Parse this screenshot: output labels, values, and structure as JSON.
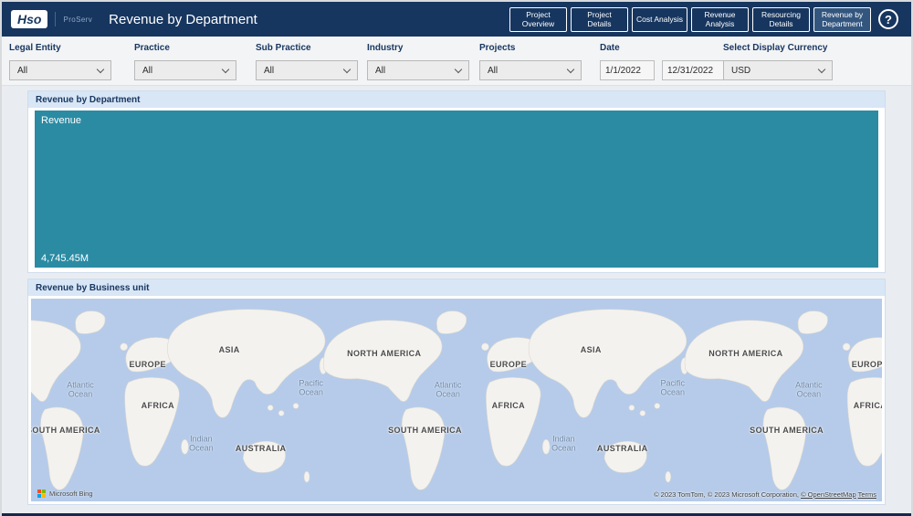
{
  "header": {
    "logo_text": "Hso",
    "brand": "ProServ",
    "title": "Revenue by Department",
    "help_label": "?",
    "nav": [
      {
        "label": "Project Overview",
        "active": false
      },
      {
        "label": "Project Details",
        "active": false
      },
      {
        "label": "Cost Analysis",
        "active": false
      },
      {
        "label": "Revenue Analysis",
        "active": false
      },
      {
        "label": "Resourcing Details",
        "active": false
      },
      {
        "label": "Revenue by Department",
        "active": true
      }
    ]
  },
  "filters": {
    "legal_entity": {
      "label": "Legal Entity",
      "value": "All"
    },
    "practice": {
      "label": "Practice",
      "value": "All"
    },
    "sub_practice": {
      "label": "Sub Practice",
      "value": "All"
    },
    "industry": {
      "label": "Industry",
      "value": "All"
    },
    "projects": {
      "label": "Projects",
      "value": "All"
    },
    "date": {
      "label": "Date",
      "start": "1/1/2022",
      "end": "12/31/2022"
    },
    "currency": {
      "label": "Select Display Currency",
      "value": "USD"
    }
  },
  "treemap_card": {
    "title": "Revenue by Department",
    "node_label": "Revenue",
    "node_value": "4,745.45M",
    "color": "#2b8ba3"
  },
  "map_card": {
    "title": "Revenue by Business unit",
    "bing_label": "Microsoft Bing",
    "attribution_prefix": "© 2023 TomTom, © 2023 Microsoft Corporation, ",
    "osm_link": "© OpenStreetMap",
    "terms_link": "Terms",
    "labels": [
      {
        "text": "SOUTH AMERICA"
      },
      {
        "text": "Atlantic\nOcean"
      },
      {
        "text": "EUROPE"
      },
      {
        "text": "AFRICA"
      },
      {
        "text": "Indian\nOcean"
      },
      {
        "text": "ASIA"
      },
      {
        "text": "AUSTRALIA"
      },
      {
        "text": "Pacific\nOcean"
      },
      {
        "text": "NORTH AMERICA"
      },
      {
        "text": "SOUTH AMERICA"
      },
      {
        "text": "Atlantic\nOcean"
      },
      {
        "text": "EUROPE"
      },
      {
        "text": "AFRICA"
      },
      {
        "text": "Indian\nOcean"
      },
      {
        "text": "ASIA"
      },
      {
        "text": "AUSTRALIA"
      },
      {
        "text": "Pacific\nOcean"
      },
      {
        "text": "NORTH AMERICA"
      },
      {
        "text": "SOUTH AMERICA"
      },
      {
        "text": "Atlantic\nOcean"
      },
      {
        "text": "EUROPE"
      },
      {
        "text": "AFRICA"
      }
    ]
  },
  "colors": {
    "header": "#17365F",
    "treemap": "#2b8ba3",
    "card_strip": "#D8E6F6",
    "map_water": "#B5CBE9"
  },
  "chart_data": [
    {
      "type": "treemap",
      "title": "Revenue by Department",
      "categories": [
        "Revenue"
      ],
      "values": [
        4745.45
      ],
      "value_labels": [
        "4,745.45M"
      ]
    },
    {
      "type": "map",
      "title": "Revenue by Business unit",
      "basemap": "Bing world road map",
      "points": []
    }
  ]
}
